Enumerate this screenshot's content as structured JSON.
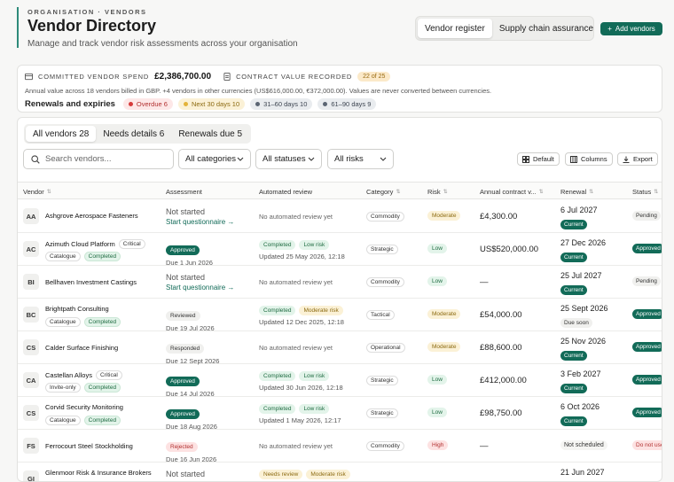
{
  "header": {
    "eyebrow": "ORGANISATION · VENDORS",
    "title": "Vendor Directory",
    "subtitle": "Manage and track vendor risk assessments across your organisation"
  },
  "view_toggle": {
    "register": "Vendor register",
    "assurance": "Supply chain assurance"
  },
  "add_button": "Add vendors",
  "spend": {
    "spend_label": "COMMITTED VENDOR SPEND",
    "spend_value": "£2,386,700.00",
    "contract_label": "CONTRACT VALUE RECORDED",
    "contract_count": "22 of 25",
    "note": "Annual value across 18 vendors billed in GBP. +4 vendors in other currencies (US$616,000.00, €372,000.00). Values are never converted between currencies.",
    "renewals_label": "Renewals and expiries",
    "chips": {
      "overdue": "Overdue 6",
      "next30": "Next 30 days 10",
      "d31_60": "31–60 days 10",
      "d61_90": "61–90 days 9"
    }
  },
  "tabs": {
    "all": "All vendors 28",
    "needs": "Needs details 6",
    "renewals": "Renewals due 5"
  },
  "filters": {
    "search_placeholder": "Search vendors...",
    "categories": "All categories",
    "statuses": "All statuses",
    "risks": "All risks"
  },
  "tools": {
    "default": "Default",
    "columns": "Columns",
    "export": "Export"
  },
  "columns": {
    "vendor": "Vendor",
    "assessment": "Assessment",
    "automated": "Automated review",
    "category": "Category",
    "risk": "Risk",
    "annual": "Annual contract v...",
    "renewal": "Renewal",
    "status": "Status"
  },
  "rows": [
    {
      "initials": "AA",
      "name": "Ashgrove Aerospace Fasteners",
      "assess_top": "Not started",
      "assess_bottom": "Start questionnaire →",
      "auto_none": "No automated review yet",
      "category": "Commodity",
      "risk": "Moderate",
      "value": "£4,300.00",
      "renew_date": "6 Jul 2027",
      "renew_status": "Current",
      "status": "Pending"
    },
    {
      "initials": "AC",
      "name": "Azimuth Cloud Platform",
      "crit": "Critical",
      "tag1": "Catalogue",
      "tag2": "Completed",
      "assess_badge": "Approved",
      "assess_due": "Due 1 Jun 2026",
      "auto_c1": "Completed",
      "auto_c2": "Low risk",
      "auto_upd": "Updated 25 May 2026, 12:18",
      "category": "Strategic",
      "risk": "Low",
      "value": "US$520,000.00",
      "renew_date": "27 Dec 2026",
      "renew_status": "Current",
      "status": "Approved"
    },
    {
      "initials": "BI",
      "name": "Bellhaven Investment Castings",
      "assess_top": "Not started",
      "assess_bottom": "Start questionnaire →",
      "auto_none": "No automated review yet",
      "category": "Commodity",
      "risk": "Low",
      "value": "—",
      "renew_date": "25 Jul 2027",
      "renew_status": "Current",
      "status": "Pending"
    },
    {
      "initials": "BC",
      "name": "Brightpath Consulting",
      "tag1": "Catalogue",
      "tag2": "Completed",
      "assess_badge": "Reviewed",
      "assess_due": "Due 19 Jul 2026",
      "auto_c1": "Completed",
      "auto_c2": "Moderate risk",
      "auto_upd": "Updated 12 Dec 2025, 12:18",
      "category": "Tactical",
      "risk": "Moderate",
      "value": "£54,000.00",
      "renew_date": "25 Sept 2026",
      "renew_status": "Due soon",
      "status": "Approved"
    },
    {
      "initials": "CS",
      "name": "Calder Surface Finishing",
      "assess_badge": "Responded",
      "assess_due": "Due 12 Sept 2026",
      "auto_none": "No automated review yet",
      "category": "Operational",
      "risk": "Moderate",
      "value": "£88,600.00",
      "renew_date": "25 Nov 2026",
      "renew_status": "Current",
      "status": "Approved"
    },
    {
      "initials": "CA",
      "name": "Castellan Alloys",
      "crit": "Critical",
      "tag1": "Invite-only",
      "tag2": "Completed",
      "assess_badge": "Approved",
      "assess_due": "Due 14 Jul 2026",
      "auto_c1": "Completed",
      "auto_c2": "Low risk",
      "auto_upd": "Updated 30 Jun 2026, 12:18",
      "category": "Strategic",
      "risk": "Low",
      "value": "£412,000.00",
      "renew_date": "3 Feb 2027",
      "renew_status": "Current",
      "status": "Approved"
    },
    {
      "initials": "CS",
      "name": "Corvid Security Monitoring",
      "tag1": "Catalogue",
      "tag2": "Completed",
      "assess_badge": "Approved",
      "assess_due": "Due 18 Aug 2026",
      "auto_c1": "Completed",
      "auto_c2": "Low risk",
      "auto_upd": "Updated 1 May 2026, 12:17",
      "category": "Strategic",
      "risk": "Low",
      "value": "£98,750.00",
      "renew_date": "6 Oct 2026",
      "renew_status": "Current",
      "status": "Approved"
    },
    {
      "initials": "FS",
      "name": "Ferrocourt Steel Stockholding",
      "assess_badge": "Rejected",
      "assess_due": "Due 16 Jun 2026",
      "auto_none": "No automated review yet",
      "category": "Commodity",
      "risk": "High",
      "value": "—",
      "renew_none": "Not scheduled",
      "status": "Do not use"
    },
    {
      "initials": "GI",
      "name": "Glenmoor Risk & Insurance Brokers",
      "assess_top": "Not started",
      "auto_c1": "Needs review",
      "auto_c2": "Moderate risk",
      "renew_date": "21 Jun 2027"
    }
  ]
}
